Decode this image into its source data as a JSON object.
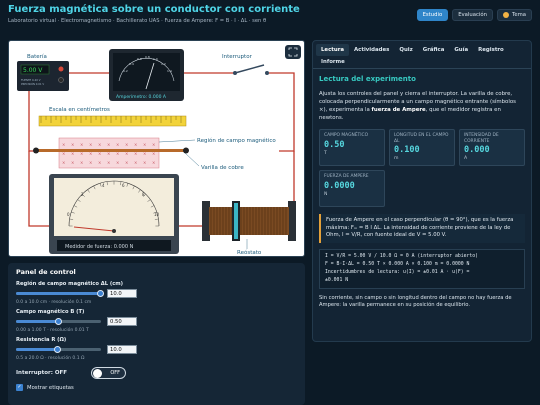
{
  "header": {
    "title": "Fuerza magnética sobre un conductor con corriente",
    "subtitle": "Laboratorio virtual · Electromagnetismo · Bachillerato UAS · Fuerza de Ampere: F = B · I · ΔL · sen θ",
    "buttons": {
      "study": "Estudio",
      "evaluation": "Evaluación",
      "theme": "Tema"
    }
  },
  "scene": {
    "battery_label": "Batería",
    "battery_display": "5.00 V",
    "battery_small": "FUENTE 0-20 V",
    "battery_small2": "PRECISIÓN 0.01 V",
    "ammeter_display": "Amperímetro: 0.000 A",
    "ammeter_scale": [
      "0.2",
      "0.4",
      "0.6",
      "0.8",
      "1.0",
      "1.2",
      "1.4"
    ],
    "switch_label": "Interruptor",
    "ruler_label": "Escala en centímetros",
    "field_label": "Región de campo magnético",
    "rod_label": "Varilla de cobre",
    "force_display": "Medidor de fuerza: 0.000 N",
    "rheostat_label": "Reóstato",
    "force_scale": [
      "0",
      "2",
      "4",
      "6",
      "8",
      "10"
    ],
    "needle_fraction": 0.0
  },
  "panel": {
    "title": "Panel de control",
    "controls": [
      {
        "label": "Región de campo magnético ΔL (cm)",
        "value": "10.0",
        "hint": "0.0 a 10.0 cm · resolución 0.1 cm",
        "fraction": 1.0
      },
      {
        "label": "Campo magnético B (T)",
        "value": "0.50",
        "hint": "0.00 a 1.00 T · resolución 0.01 T",
        "fraction": 0.5
      },
      {
        "label": "Resistencia R (Ω)",
        "value": "10.0",
        "hint": "0.5 a 20.0 Ω · resolución 0.1 Ω",
        "fraction": 0.49
      }
    ],
    "switch_label": "Interruptor: OFF",
    "switch_state": "OFF",
    "checkbox_label": "Mostrar etiquetas"
  },
  "tabs": [
    "Lectura",
    "Actividades",
    "Quiz",
    "Gráfica",
    "Guía",
    "Registro",
    "Informe"
  ],
  "reading": {
    "title": "Lectura del experimento",
    "intro_a": "Ajusta los controles del panel y cierra el interruptor. La varilla de cobre, colocada perpendicularmente a un campo magnético entrante (símbolos ×), experimenta la ",
    "intro_b": "fuerza de Ampere",
    "intro_c": ", que el medidor registra en newtons.",
    "cards": [
      {
        "label": "Campo magnético",
        "value": "0.50",
        "unit": "T"
      },
      {
        "label": "Longitud en el campo ΔL",
        "value": "0.100",
        "unit": "m"
      },
      {
        "label": "Intensidad de corriente",
        "value": "0.000",
        "unit": "A"
      },
      {
        "label": "Fuerza de Ampere",
        "value": "0.0000",
        "unit": "N"
      }
    ],
    "note": "Fuerza de Ampere en el caso perpendicular (θ = 90°), que es la fuerza máxima: Fₘ = B I ΔL. La intensidad de corriente proviene de la ley de Ohm, I = V/R, con fuente ideal de V = 5.00 V.",
    "code": [
      "I = V/R = 5.00 V / 10.0 Ω = 0 A (interruptor abierto)",
      "F = B·I·ΔL = 0.50 T × 0.000 A × 0.100 m = 0.0000 N",
      "Incertidumbres de lectura: u(I) = ±0.01 A · u(F) =",
      "±0.001 N"
    ],
    "footer": "Sin corriente, sin campo o sin longitud dentro del campo no hay fuerza de Ampere: la varilla permanece en su posición de equilibrio."
  }
}
